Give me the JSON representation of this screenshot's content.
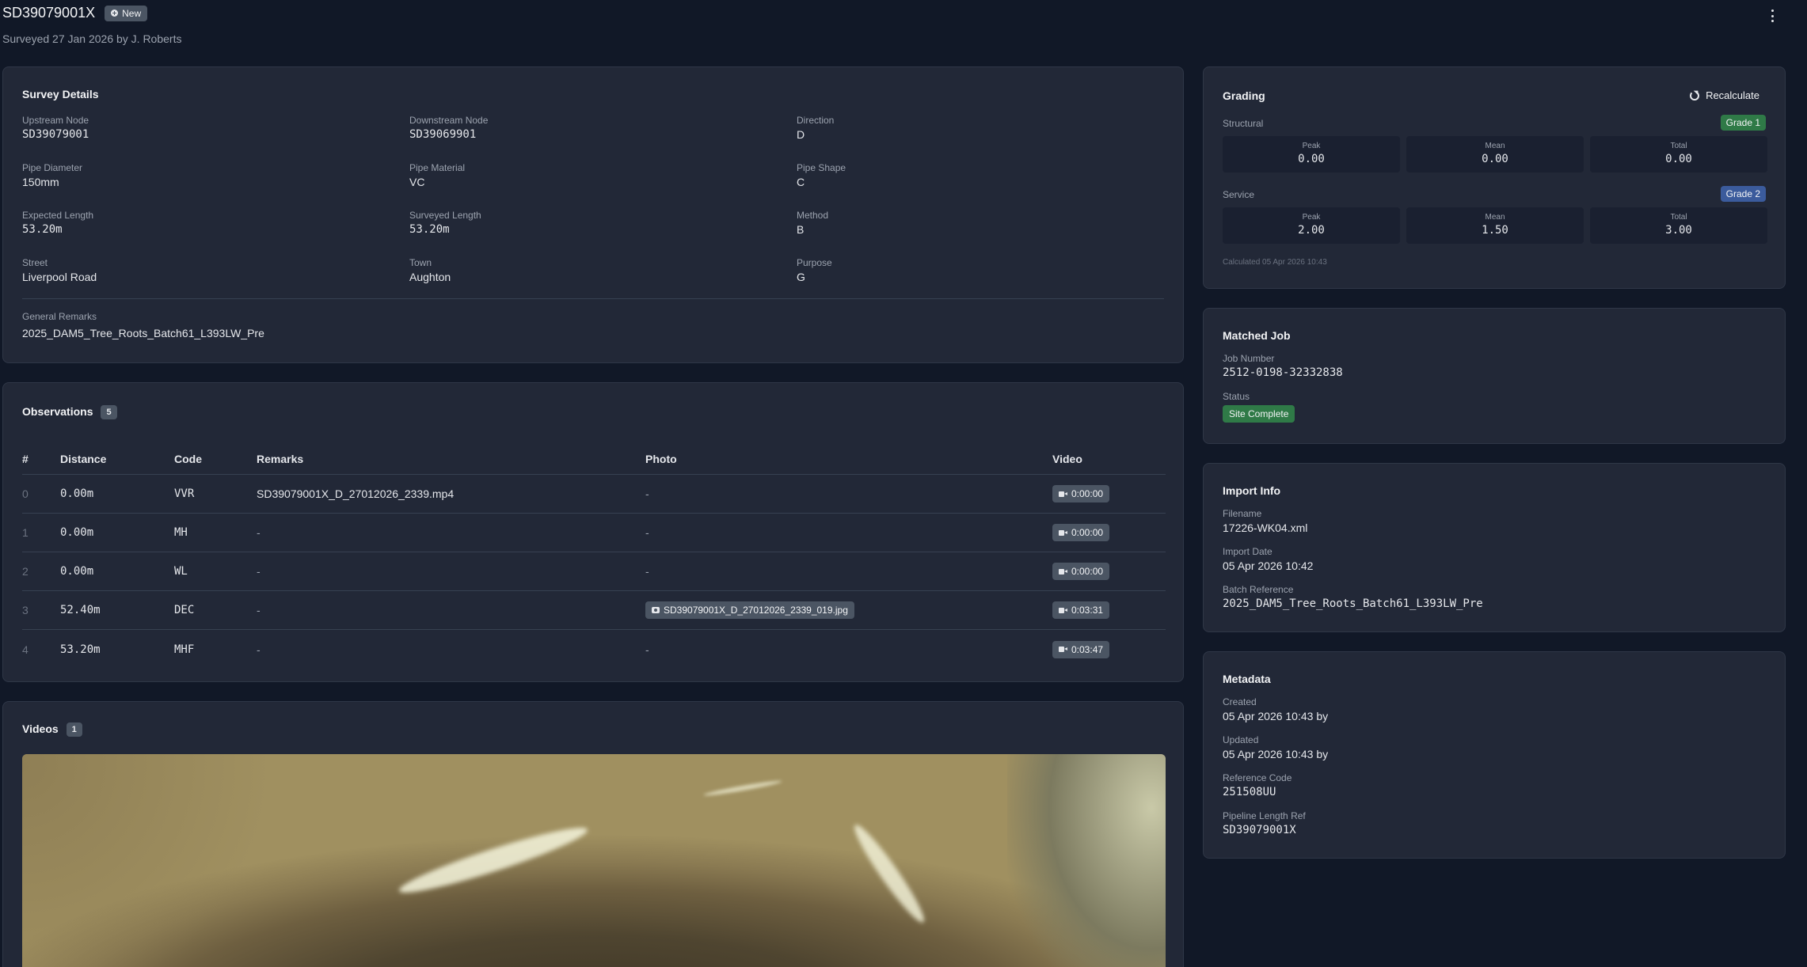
{
  "header": {
    "title": "SD39079001X",
    "status_badge": "New",
    "subtitle": "Surveyed 27 Jan 2026 by J. Roberts"
  },
  "survey_details": {
    "title": "Survey Details",
    "fields": [
      {
        "label": "Upstream Node",
        "value": "SD39079001"
      },
      {
        "label": "Downstream Node",
        "value": "SD39069901"
      },
      {
        "label": "Direction",
        "value": "D"
      },
      {
        "label": "Pipe Diameter",
        "value": "150mm"
      },
      {
        "label": "Pipe Material",
        "value": "VC"
      },
      {
        "label": "Pipe Shape",
        "value": "C"
      },
      {
        "label": "Expected Length",
        "value": "53.20m"
      },
      {
        "label": "Surveyed Length",
        "value": "53.20m"
      },
      {
        "label": "Method",
        "value": "B"
      },
      {
        "label": "Street",
        "value": "Liverpool Road"
      },
      {
        "label": "Town",
        "value": "Aughton"
      },
      {
        "label": "Purpose",
        "value": "G"
      }
    ],
    "remarks_label": "General Remarks",
    "remarks_value": "2025_DAM5_Tree_Roots_Batch61_L393LW_Pre"
  },
  "observations": {
    "title": "Observations",
    "count": "5",
    "columns": [
      "#",
      "Distance",
      "Code",
      "Remarks",
      "Photo",
      "Video"
    ],
    "rows": [
      {
        "idx": "0",
        "distance": "0.00m",
        "code": "VVR",
        "remarks": "SD39079001X_D_27012026_2339.mp4",
        "photo": "-",
        "video": "0:00:00"
      },
      {
        "idx": "1",
        "distance": "0.00m",
        "code": "MH",
        "remarks": "-",
        "photo": "-",
        "video": "0:00:00"
      },
      {
        "idx": "2",
        "distance": "0.00m",
        "code": "WL",
        "remarks": "-",
        "photo": "-",
        "video": "0:00:00"
      },
      {
        "idx": "3",
        "distance": "52.40m",
        "code": "DEC",
        "remarks": "-",
        "photo": "SD39079001X_D_27012026_2339_019.jpg",
        "video": "0:03:31"
      },
      {
        "idx": "4",
        "distance": "53.20m",
        "code": "MHF",
        "remarks": "-",
        "photo": "-",
        "video": "0:03:47"
      }
    ]
  },
  "videos": {
    "title": "Videos",
    "count": "1"
  },
  "grading": {
    "title": "Grading",
    "recalculate_label": "Recalculate",
    "structural": {
      "label": "Structural",
      "grade": "Grade 1",
      "stats": [
        {
          "label": "Peak",
          "value": "0.00"
        },
        {
          "label": "Mean",
          "value": "0.00"
        },
        {
          "label": "Total",
          "value": "0.00"
        }
      ]
    },
    "service": {
      "label": "Service",
      "grade": "Grade 2",
      "stats": [
        {
          "label": "Peak",
          "value": "2.00"
        },
        {
          "label": "Mean",
          "value": "1.50"
        },
        {
          "label": "Total",
          "value": "3.00"
        }
      ]
    },
    "calculated_note": "Calculated 05 Apr 2026 10:43"
  },
  "matched_job": {
    "title": "Matched Job",
    "job_number_label": "Job Number",
    "job_number": "2512-0198-32332838",
    "status_label": "Status",
    "status": "Site Complete"
  },
  "import_info": {
    "title": "Import Info",
    "filename_label": "Filename",
    "filename": "17226-WK04.xml",
    "import_date_label": "Import Date",
    "import_date": "05 Apr 2026 10:42",
    "batch_label": "Batch Reference",
    "batch": "2025_DAM5_Tree_Roots_Batch61_L393LW_Pre"
  },
  "metadata": {
    "title": "Metadata",
    "created_label": "Created",
    "created": "05 Apr 2026 10:43 by",
    "updated_label": "Updated",
    "updated": "05 Apr 2026 10:43 by",
    "reference_label": "Reference Code",
    "reference": "251508UU",
    "pipeline_label": "Pipeline Length Ref",
    "pipeline": "SD39079001X"
  },
  "colors": {
    "background": "#111827",
    "card": "#222837",
    "grade1": "#2f7a47",
    "grade2": "#3b5b9c",
    "status_complete": "#2f7a47"
  }
}
